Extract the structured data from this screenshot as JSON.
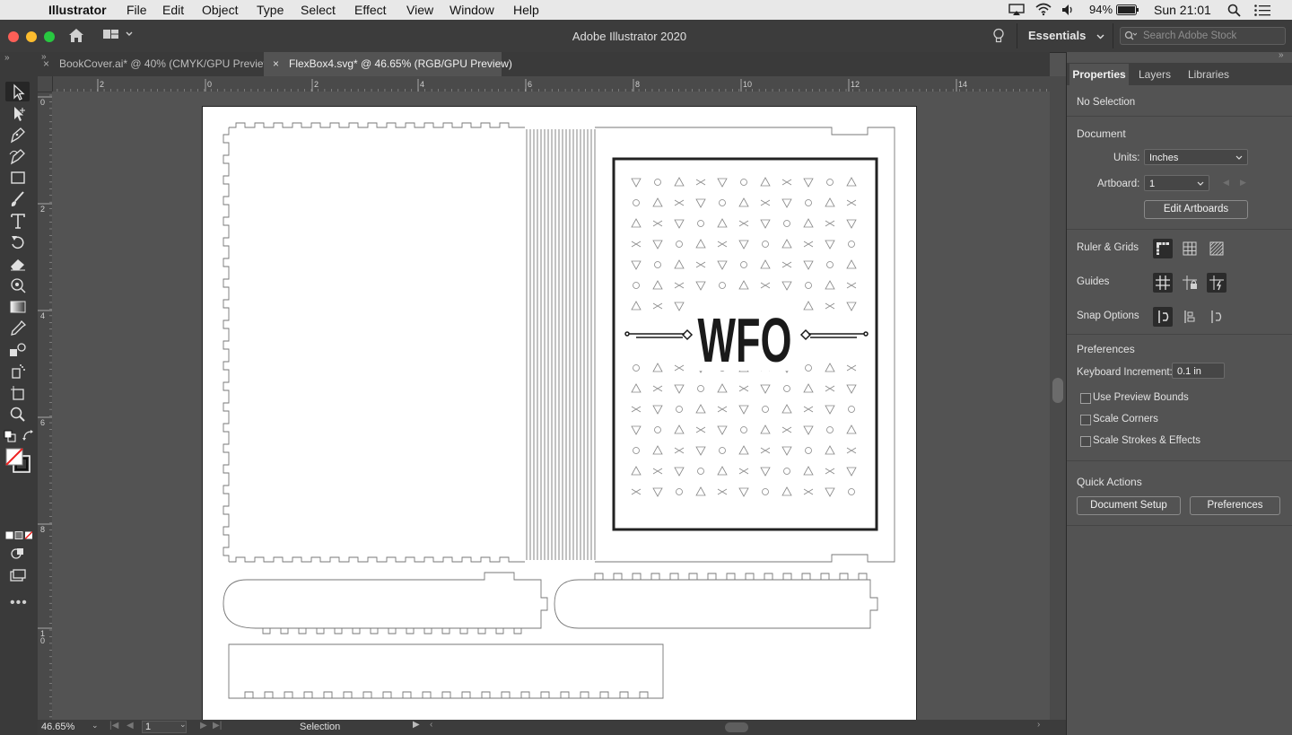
{
  "menubar": {
    "app_name": "Illustrator",
    "menus": [
      "File",
      "Edit",
      "Object",
      "Type",
      "Select",
      "Effect",
      "View",
      "Window",
      "Help"
    ],
    "battery": "94%",
    "clock": "Sun 21:01"
  },
  "appbar": {
    "title": "Adobe Illustrator 2020",
    "workspace": "Essentials",
    "search_placeholder": "Search Adobe Stock"
  },
  "tabs": [
    {
      "label": "BookCover.ai* @ 40% (CMYK/GPU Preview)",
      "active": false
    },
    {
      "label": "FlexBox4.svg* @ 46.65% (RGB/GPU Preview)",
      "active": true
    }
  ],
  "rulers": {
    "top": [
      "2",
      "0",
      "2",
      "4",
      "6",
      "8",
      "10",
      "12",
      "14"
    ],
    "left": [
      "0",
      "2",
      "4",
      "6",
      "8",
      "1\n0"
    ]
  },
  "artwork": {
    "title_text": "WFO"
  },
  "status": {
    "zoom": "46.65%",
    "artboard": "1",
    "tool": "Selection"
  },
  "panel": {
    "tabs": [
      "Properties",
      "Layers",
      "Libraries"
    ],
    "selection_state": "No Selection",
    "document": {
      "title": "Document",
      "units_label": "Units:",
      "units_value": "Inches",
      "artboard_label": "Artboard:",
      "artboard_value": "1",
      "edit_artboards": "Edit Artboards"
    },
    "ruler_grids": "Ruler & Grids",
    "guides": "Guides",
    "snap_options": "Snap Options",
    "preferences": {
      "title": "Preferences",
      "keyboard_increment_label": "Keyboard Increment:",
      "keyboard_increment_value": "0.1 in",
      "checkboxes": [
        "Use Preview Bounds",
        "Scale Corners",
        "Scale Strokes & Effects"
      ]
    },
    "quick_actions": {
      "title": "Quick Actions",
      "document_setup": "Document Setup",
      "preferences": "Preferences"
    }
  },
  "colors": {
    "ui_dark": "#3a3a3a",
    "ui_mid": "#535353",
    "accent": "#2c79d6"
  }
}
